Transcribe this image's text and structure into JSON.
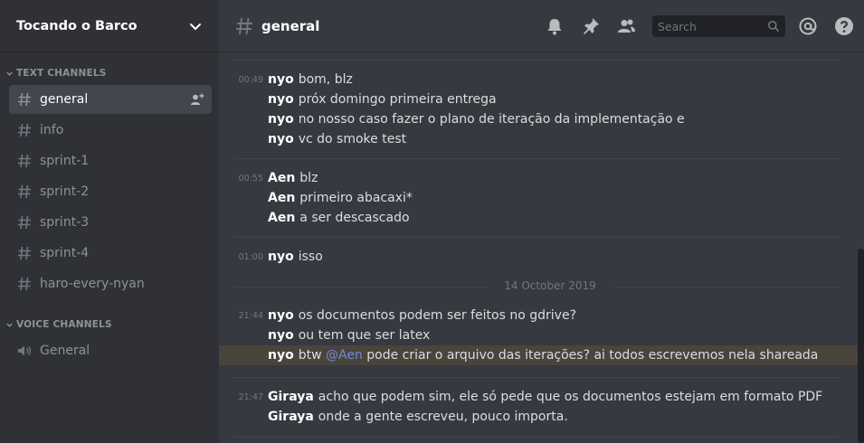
{
  "server": {
    "name": "Tocando o Barco"
  },
  "categories": {
    "text": "TEXT CHANNELS",
    "voice": "VOICE CHANNELS"
  },
  "channels": {
    "text": [
      "general",
      "info",
      "sprint-1",
      "sprint-2",
      "sprint-3",
      "sprint-4",
      "haro-every-nyan"
    ],
    "voice": [
      "General"
    ]
  },
  "header": {
    "channel": "general",
    "search_placeholder": "Search",
    "icons": [
      "bell-icon",
      "pin-icon",
      "members-icon",
      "search-icon",
      "mention-icon",
      "help-icon"
    ]
  },
  "messages": {
    "m1": {
      "time": "00:49",
      "author": "nyo",
      "text": "bom, blz"
    },
    "m2": {
      "author": "nyo",
      "text": "próx domingo primeira entrega"
    },
    "m3": {
      "author": "nyo",
      "text": "no nosso caso fazer o plano de iteração da implementação e"
    },
    "m4": {
      "author": "nyo",
      "text": "vc do smoke test"
    },
    "m5": {
      "time": "00:55",
      "author": "Aen",
      "text": "blz"
    },
    "m6": {
      "author": "Aen",
      "text": "primeiro abacaxi*"
    },
    "m7": {
      "author": "Aen",
      "text": "a ser descascado"
    },
    "m8": {
      "time": "01:00",
      "author": "nyo",
      "text": "isso"
    },
    "date": "14 October 2019",
    "m9": {
      "time": "21:44",
      "author": "nyo",
      "text": "os documentos podem ser feitos no gdrive?"
    },
    "m10": {
      "author": "nyo",
      "text": "ou tem que ser latex"
    },
    "m11": {
      "author": "nyo",
      "text_before": "btw ",
      "mention": "@Aen",
      "text_after": " pode criar o arquivo das iterações? ai todos escrevemos nela shareada"
    },
    "m12": {
      "time": "21:47",
      "author": "Giraya",
      "text": "acho que podem sim, ele só pede que os documentos estejam em formato PDF"
    },
    "m13": {
      "author": "Giraya",
      "text": "onde a gente escreveu, pouco importa."
    }
  },
  "colors": {
    "sidebar": "#2f3136",
    "main": "#36393f",
    "active_channel": "#42464d",
    "highlight": "#49443c",
    "mention": "#7289da"
  }
}
